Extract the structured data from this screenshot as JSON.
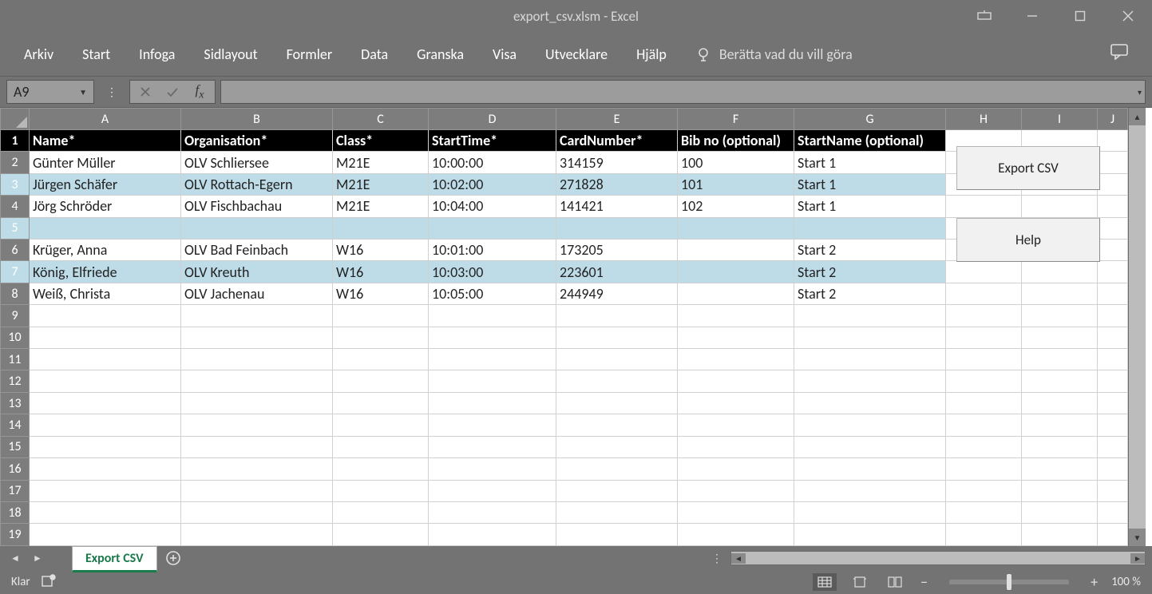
{
  "title": "export_csv.xlsm  -  Excel",
  "ribbon": {
    "tabs": [
      "Arkiv",
      "Start",
      "Infoga",
      "Sidlayout",
      "Formler",
      "Data",
      "Granska",
      "Visa",
      "Utvecklare",
      "Hjälp"
    ],
    "tell_me": "Berätta vad du vill göra"
  },
  "name_box": "A9",
  "columns": [
    "A",
    "B",
    "C",
    "D",
    "E",
    "F",
    "G",
    "H",
    "I",
    "J"
  ],
  "col_widths": [
    "c-A",
    "c-B",
    "c-C",
    "c-D",
    "c-E",
    "c-F",
    "c-G",
    "c-H",
    "c-I",
    "c-J"
  ],
  "headers": [
    "Name*",
    "Organisation*",
    "Class*",
    "StartTime*",
    "CardNumber*",
    "Bib no (optional)",
    "StartName (optional)"
  ],
  "rows": [
    {
      "n": 1,
      "type": "hdr"
    },
    {
      "n": 2,
      "cells": [
        "Günter Müller",
        "OLV Schliersee",
        "M21E",
        "10:00:00",
        "314159",
        "100",
        "Start 1"
      ]
    },
    {
      "n": 3,
      "band": true,
      "cells": [
        "Jürgen Schäfer",
        "OLV Rottach-Egern",
        "M21E",
        "10:02:00",
        "271828",
        "101",
        "Start 1"
      ]
    },
    {
      "n": 4,
      "cells": [
        "Jörg Schröder",
        "OLV Fischbachau",
        "M21E",
        "10:04:00",
        "141421",
        "102",
        "Start 1"
      ]
    },
    {
      "n": 5,
      "band": true,
      "cells": [
        "",
        "",
        "",
        "",
        "",
        "",
        ""
      ]
    },
    {
      "n": 6,
      "cells": [
        "Krüger, Anna",
        "OLV Bad Feinbach",
        "W16",
        "10:01:00",
        "173205",
        "",
        "Start 2"
      ]
    },
    {
      "n": 7,
      "band": true,
      "cells": [
        "König, Elfriede",
        "OLV Kreuth",
        "W16",
        "10:03:00",
        "223601",
        "",
        "Start 2"
      ]
    },
    {
      "n": 8,
      "cells": [
        "Weiß, Christa",
        "OLV Jachenau",
        "W16",
        "10:05:00",
        "244949",
        "",
        "Start 2"
      ]
    },
    {
      "n": 9,
      "cells": [
        "",
        "",
        "",
        "",
        "",
        "",
        ""
      ],
      "plain": true
    },
    {
      "n": 10,
      "cells": [
        "",
        "",
        "",
        "",
        "",
        "",
        ""
      ],
      "plain": true
    },
    {
      "n": 11,
      "cells": [
        "",
        "",
        "",
        "",
        "",
        "",
        ""
      ],
      "plain": true
    },
    {
      "n": 12,
      "cells": [
        "",
        "",
        "",
        "",
        "",
        "",
        ""
      ],
      "plain": true
    },
    {
      "n": 13,
      "cells": [
        "",
        "",
        "",
        "",
        "",
        "",
        ""
      ],
      "plain": true
    },
    {
      "n": 14,
      "cells": [
        "",
        "",
        "",
        "",
        "",
        "",
        ""
      ],
      "plain": true
    },
    {
      "n": 15,
      "cells": [
        "",
        "",
        "",
        "",
        "",
        "",
        ""
      ],
      "plain": true
    },
    {
      "n": 16,
      "cells": [
        "",
        "",
        "",
        "",
        "",
        "",
        ""
      ],
      "plain": true
    },
    {
      "n": 17,
      "cells": [
        "",
        "",
        "",
        "",
        "",
        "",
        ""
      ],
      "plain": true
    },
    {
      "n": 18,
      "cells": [
        "",
        "",
        "",
        "",
        "",
        "",
        ""
      ],
      "plain": true
    },
    {
      "n": 19,
      "cells": [
        "",
        "",
        "",
        "",
        "",
        "",
        ""
      ],
      "plain": true
    }
  ],
  "buttons": {
    "export": "Export CSV",
    "help": "Help"
  },
  "sheet_tab": "Export CSV",
  "status": {
    "ready": "Klar",
    "zoom": "100 %"
  }
}
